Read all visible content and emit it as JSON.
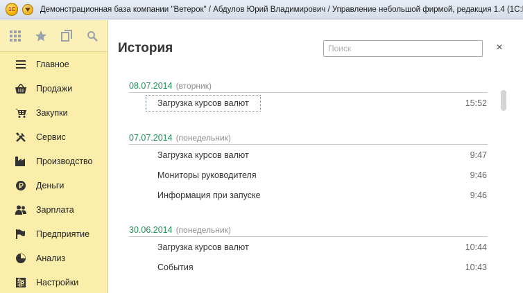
{
  "window": {
    "logo_text": "1С",
    "title": "Демонстрационная база компании \"Ветерок\" / Абдулов Юрий Владимирович / Управление небольшой фирмой, редакция 1.4  (1С:Пред"
  },
  "toolbar": {
    "icons": [
      "apps-grid-icon",
      "star-icon",
      "history-icon",
      "search-icon"
    ]
  },
  "sidebar": {
    "items": [
      {
        "label": "Главное",
        "icon": "menu-lines-icon"
      },
      {
        "label": "Продажи",
        "icon": "basket-icon"
      },
      {
        "label": "Закупки",
        "icon": "cart-icon"
      },
      {
        "label": "Сервис",
        "icon": "tools-icon"
      },
      {
        "label": "Производство",
        "icon": "factory-icon"
      },
      {
        "label": "Деньги",
        "icon": "ruble-coin-icon"
      },
      {
        "label": "Зарплата",
        "icon": "people-icon"
      },
      {
        "label": "Предприятие",
        "icon": "flag-icon"
      },
      {
        "label": "Анализ",
        "icon": "pie-chart-icon"
      },
      {
        "label": "Настройки",
        "icon": "settings-icon"
      }
    ]
  },
  "main": {
    "title": "История",
    "search_placeholder": "Поиск",
    "close_label": "×",
    "groups": [
      {
        "date": "08.07.2014",
        "day": "(вторник)",
        "entries": [
          {
            "name": "Загрузка курсов валют",
            "time": "15:52",
            "selected": true
          }
        ]
      },
      {
        "date": "07.07.2014",
        "day": "(понедельник)",
        "entries": [
          {
            "name": "Загрузка курсов валют",
            "time": "9:47"
          },
          {
            "name": "Мониторы руководителя",
            "time": "9:46"
          },
          {
            "name": "Информация при запуске",
            "time": "9:46"
          }
        ]
      },
      {
        "date": "30.06.2014",
        "day": "(понедельник)",
        "entries": [
          {
            "name": "Загрузка курсов валют",
            "time": "10:44"
          },
          {
            "name": "События",
            "time": "10:43"
          }
        ]
      }
    ]
  }
}
